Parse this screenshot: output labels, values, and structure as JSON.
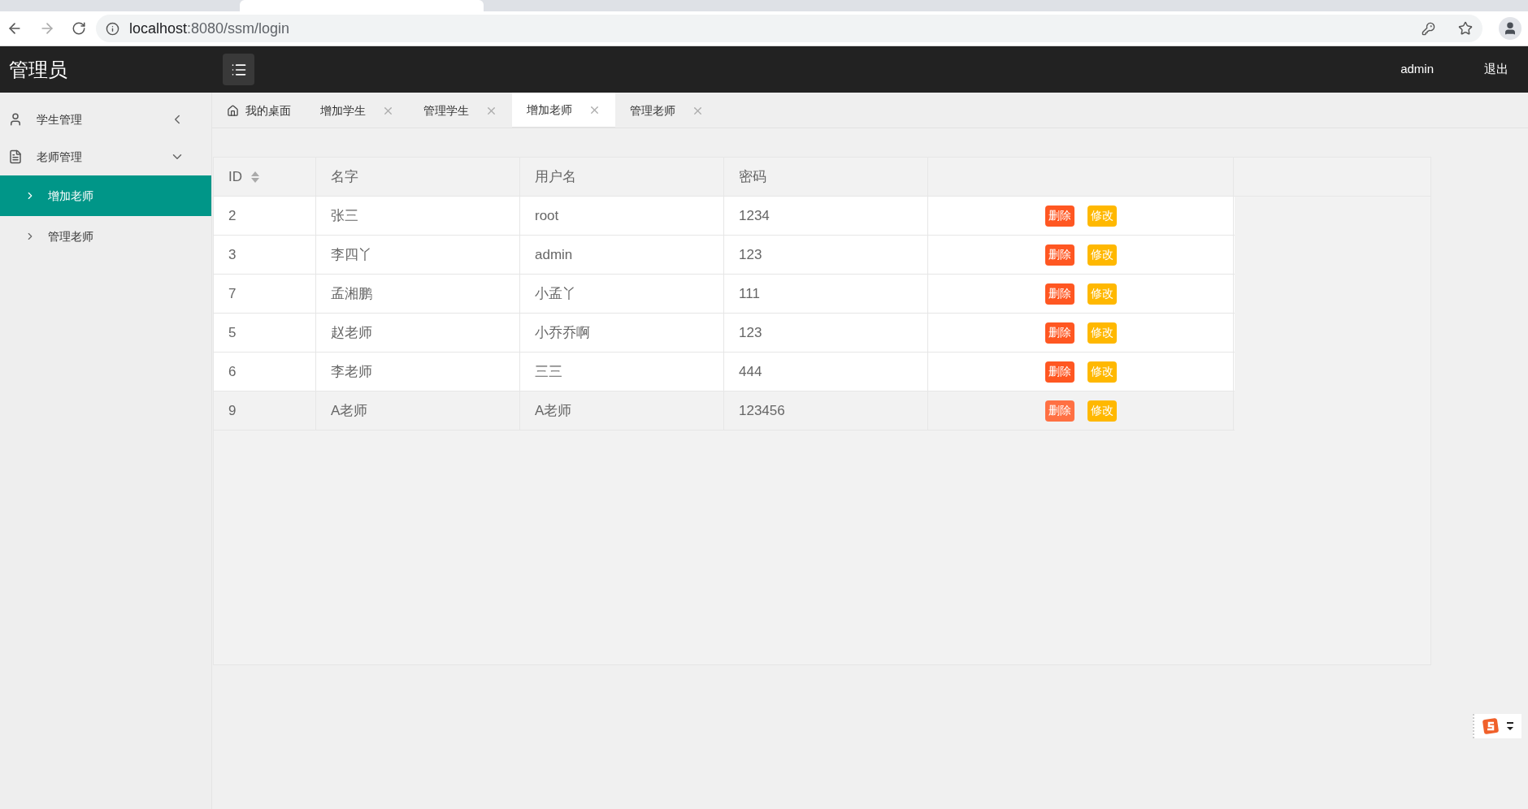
{
  "browser": {
    "url_host": "localhost",
    "url_path": ":8080/ssm/login"
  },
  "header": {
    "title": "管理员",
    "user": "admin",
    "logout": "退出"
  },
  "sidebar": {
    "items": [
      {
        "label": "学生管理",
        "kind": "person",
        "expanded": false
      },
      {
        "label": "老师管理",
        "kind": "document",
        "expanded": true,
        "children": [
          {
            "label": "增加老师",
            "selected": true
          },
          {
            "label": "管理老师",
            "selected": false
          }
        ]
      }
    ]
  },
  "tabs": [
    {
      "label": "我的桌面",
      "kind": "home",
      "selected": false
    },
    {
      "label": "增加学生",
      "kind": "closable",
      "selected": false
    },
    {
      "label": "管理学生",
      "kind": "closable",
      "selected": false
    },
    {
      "label": "增加老师",
      "kind": "closable",
      "selected": true
    },
    {
      "label": "管理老师",
      "kind": "closable",
      "selected": false
    }
  ],
  "table": {
    "columns": [
      "ID",
      "名字",
      "用户名",
      "密码"
    ],
    "rows": [
      {
        "cells": [
          "2",
          "张三",
          "root",
          "1234"
        ],
        "delete": "删除",
        "edit": "修改",
        "selected": false
      },
      {
        "cells": [
          "3",
          "李四丫",
          "admin",
          "123"
        ],
        "delete": "删除",
        "edit": "修改",
        "selected": false
      },
      {
        "cells": [
          "7",
          "孟湘鹏",
          "小孟丫",
          "111"
        ],
        "delete": "删除",
        "edit": "修改",
        "selected": false
      },
      {
        "cells": [
          "5",
          "赵老师",
          "小乔乔啊",
          "123"
        ],
        "delete": "删除",
        "edit": "修改",
        "selected": false
      },
      {
        "cells": [
          "6",
          "李老师",
          "三三",
          "444"
        ],
        "delete": "删除",
        "edit": "修改",
        "selected": false
      },
      {
        "cells": [
          "9",
          "A老师",
          "A老师",
          "123456"
        ],
        "delete": "删除",
        "edit": "修改",
        "selected": true
      }
    ]
  }
}
